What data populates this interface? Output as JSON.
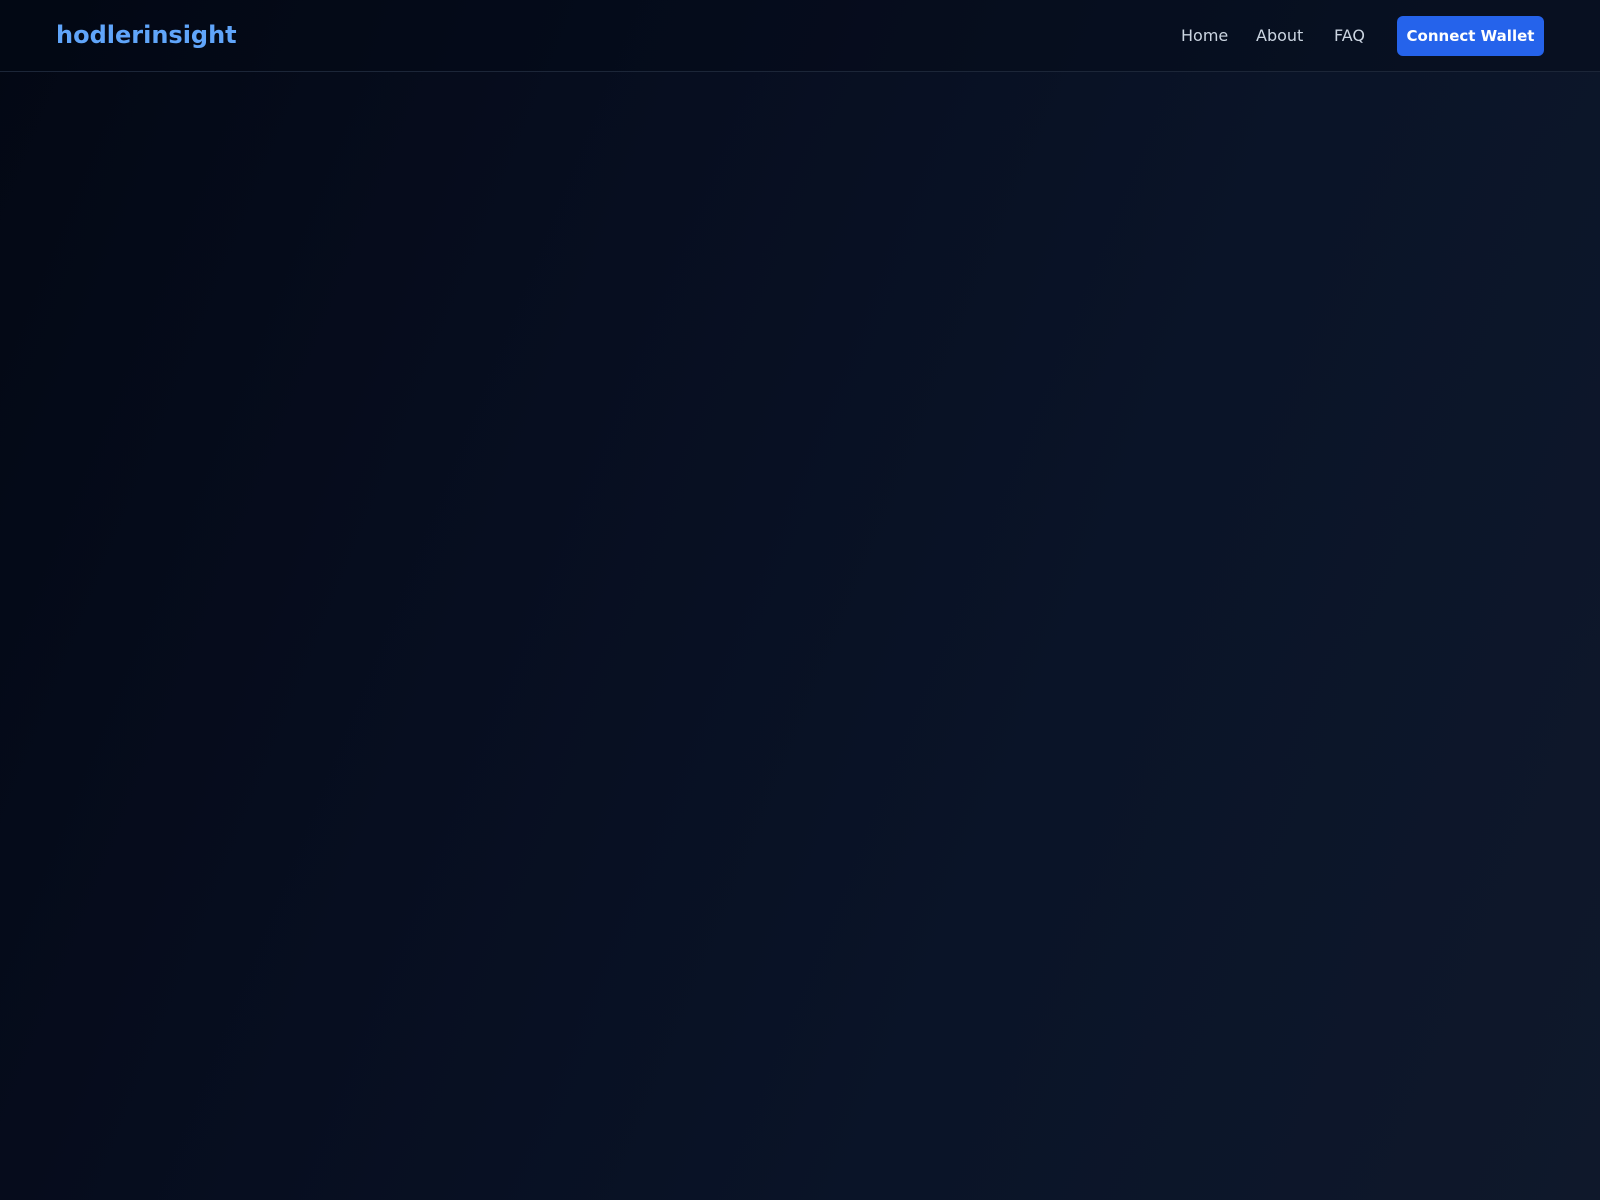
{
  "header": {
    "logo": "hodlerinsight",
    "nav": {
      "home": "Home",
      "about": "About",
      "faq": "FAQ"
    },
    "connect_wallet_label": "Connect Wallet"
  },
  "colors": {
    "brand": "#60a5fa",
    "accent_button": "#2563eb",
    "background_dark": "#030814",
    "background_light": "#0f182b",
    "nav_text": "#cbd5e1"
  }
}
